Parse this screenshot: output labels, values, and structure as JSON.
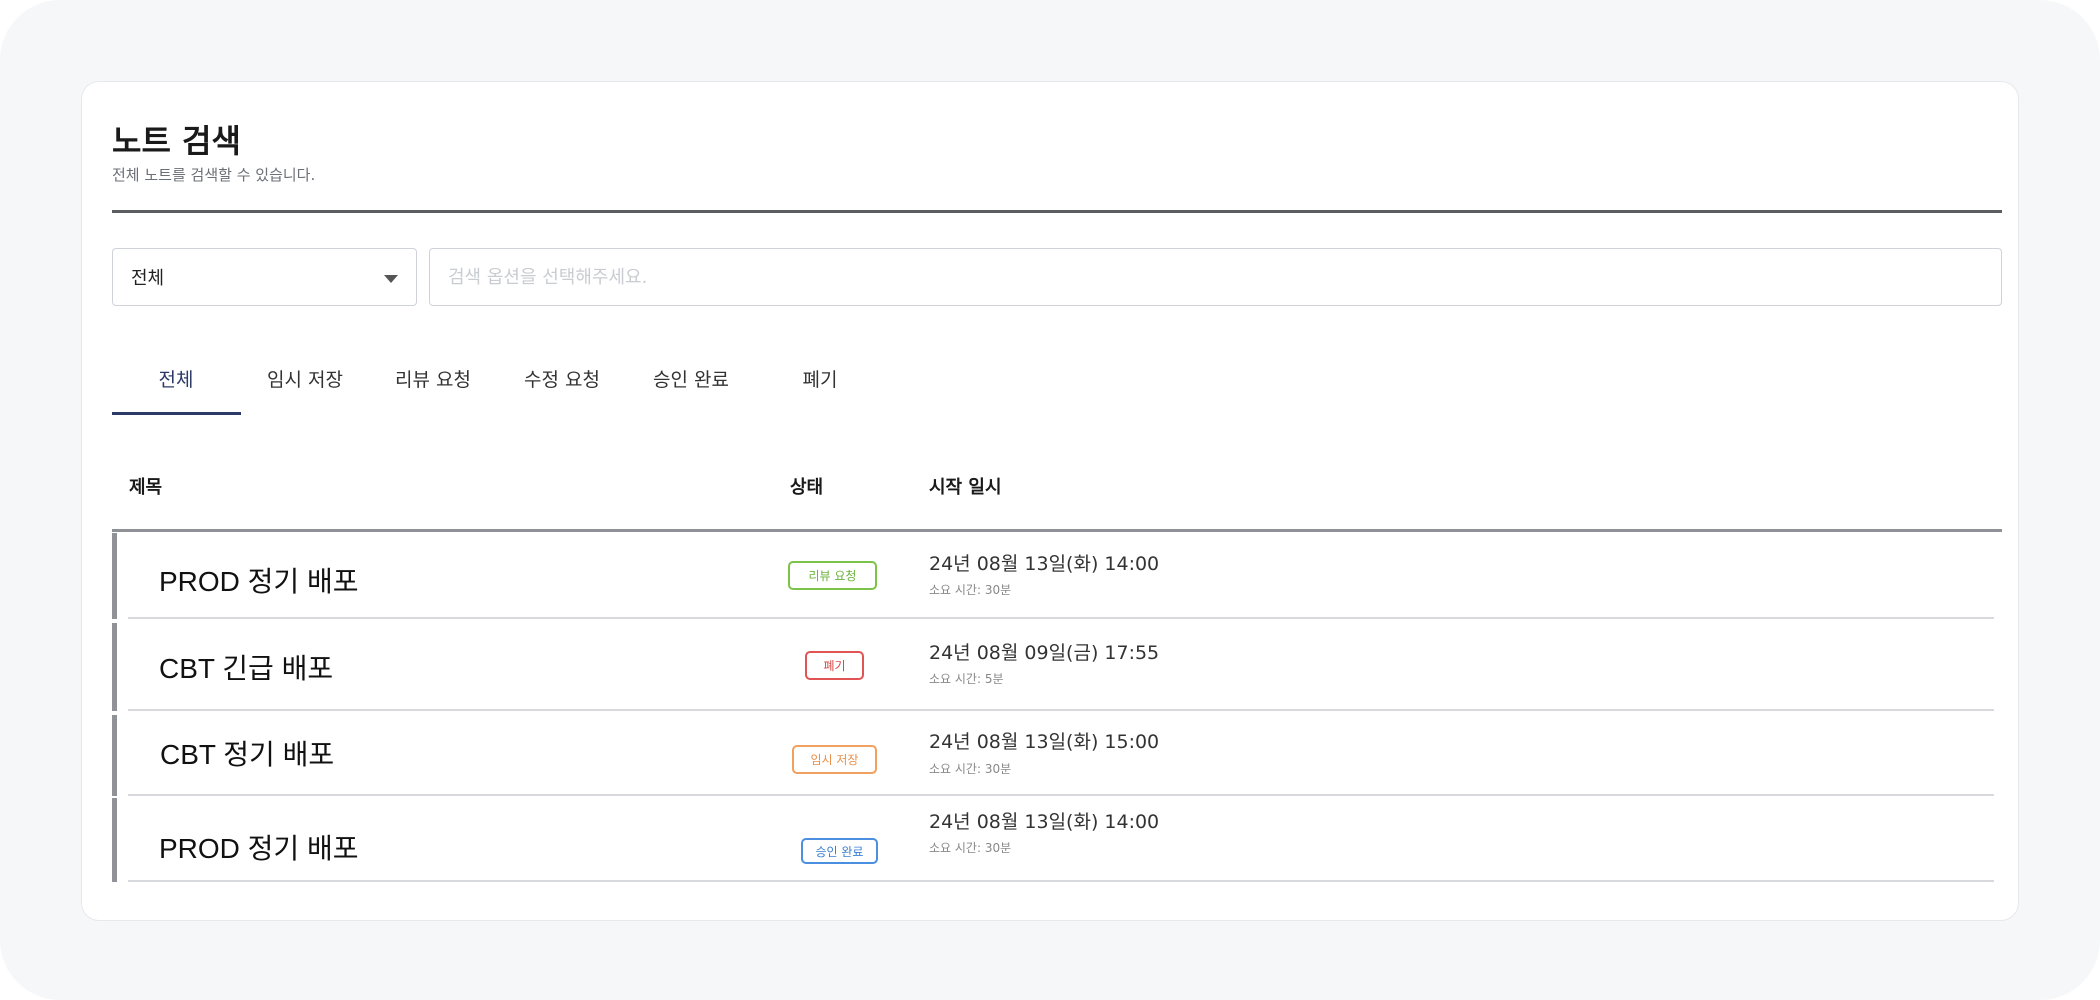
{
  "page": {
    "title": "노트 검색",
    "subtitle": "전체 노트를 검색할 수 있습니다."
  },
  "filter": {
    "selected": "전체",
    "search_placeholder": "검색 옵션을 선택해주세요."
  },
  "tabs": [
    {
      "label": "전체",
      "active": true
    },
    {
      "label": "임시 저장",
      "active": false
    },
    {
      "label": "리뷰 요청",
      "active": false
    },
    {
      "label": "수정 요청",
      "active": false
    },
    {
      "label": "승인 완료",
      "active": false
    },
    {
      "label": "폐기",
      "active": false
    }
  ],
  "table": {
    "columns": [
      "제목",
      "상태",
      "시작 일시"
    ],
    "rows": [
      {
        "title": "PROD 정기 배포",
        "status": "리뷰 요청",
        "status_color": "#7cc34a",
        "date": "24년 08월 13일(화) 14:00",
        "duration": "소요 시간: 30분"
      },
      {
        "title": "CBT 긴급 배포",
        "status": "폐기",
        "status_color": "#e05454",
        "date": "24년 08월 09일(금) 17:55",
        "duration": "소요 시간: 5분"
      },
      {
        "title": "CBT 정기 배포",
        "status": "임시 저장",
        "status_color": "#f0a060",
        "date": "24년 08월 13일(화) 15:00",
        "duration": "소요 시간: 30분"
      },
      {
        "title": "PROD 정기 배포",
        "status": "승인 완료",
        "status_color": "#4a8fe0",
        "date": "24년 08월 13일(화) 14:00",
        "duration": "소요 시간: 30분"
      }
    ]
  },
  "colors": {
    "accent": "#2b3a67",
    "background": "#f6f7f9"
  }
}
